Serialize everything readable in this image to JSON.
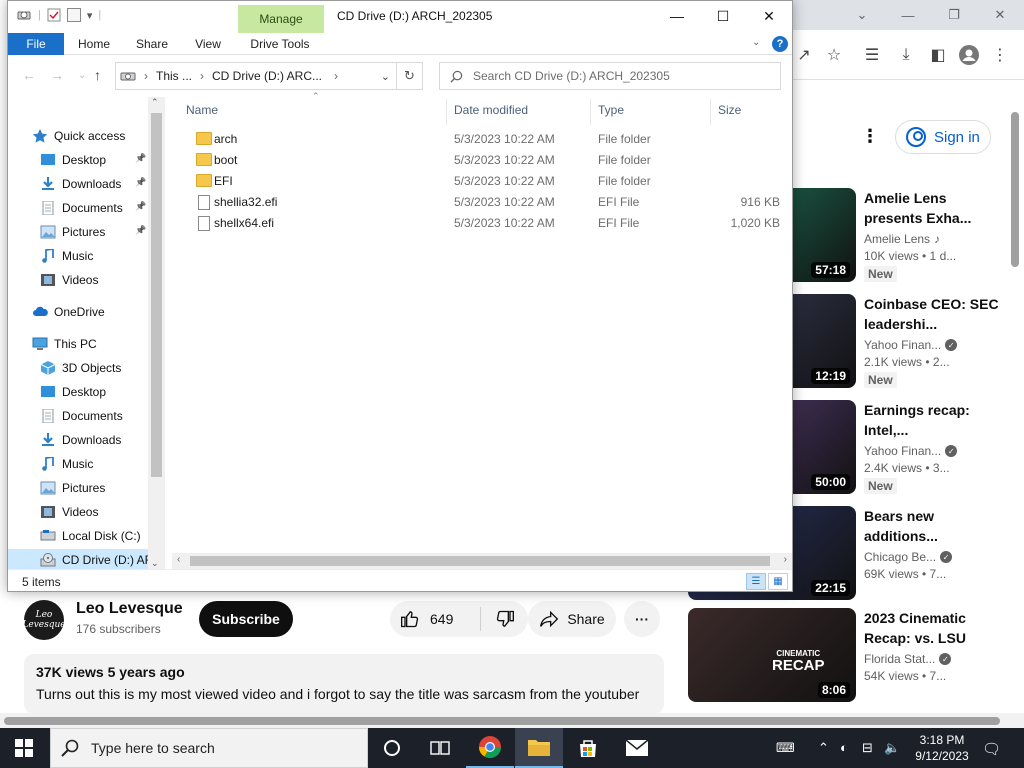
{
  "explorer": {
    "title": "CD Drive (D:) ARCH_202305",
    "manage_tab": "Manage",
    "ribbon_tabs": [
      "File",
      "Home",
      "Share",
      "View",
      "Drive Tools"
    ],
    "address": {
      "segment1": "This ...",
      "segment2": "CD Drive (D:) ARC..."
    },
    "search_placeholder": "Search CD Drive (D:) ARCH_202305",
    "columns": {
      "name": "Name",
      "date": "Date modified",
      "type": "Type",
      "size": "Size"
    },
    "files": [
      {
        "name": "arch",
        "date": "5/3/2023 10:22 AM",
        "type": "File folder",
        "size": "",
        "kind": "folder"
      },
      {
        "name": "boot",
        "date": "5/3/2023 10:22 AM",
        "type": "File folder",
        "size": "",
        "kind": "folder"
      },
      {
        "name": "EFI",
        "date": "5/3/2023 10:22 AM",
        "type": "File folder",
        "size": "",
        "kind": "folder"
      },
      {
        "name": "shellia32.efi",
        "date": "5/3/2023 10:22 AM",
        "type": "EFI File",
        "size": "916 KB",
        "kind": "file"
      },
      {
        "name": "shellx64.efi",
        "date": "5/3/2023 10:22 AM",
        "type": "EFI File",
        "size": "1,020 KB",
        "kind": "file"
      }
    ],
    "nav": {
      "quick_access": "Quick access",
      "qa_items": [
        "Desktop",
        "Downloads",
        "Documents",
        "Pictures",
        "Music",
        "Videos"
      ],
      "onedrive": "OneDrive",
      "this_pc": "This PC",
      "pc_items": [
        "3D Objects",
        "Desktop",
        "Documents",
        "Downloads",
        "Music",
        "Pictures",
        "Videos",
        "Local Disk (C:)",
        "CD Drive (D:) AR"
      ]
    },
    "status": "5 items",
    "colors": {
      "accent": "#1a6fc9",
      "manage": "#c7e8a0",
      "folder": "#f5c84c"
    }
  },
  "youtube": {
    "sign_in": "Sign in",
    "channel": {
      "name": "Leo Levesque",
      "subscribers": "176 subscribers",
      "avatar_text": "Leo Levesque",
      "subscribe": "Subscribe",
      "likes": "649",
      "share": "Share"
    },
    "description": {
      "stats": "37K views  5 years ago",
      "text": "Turns out this is my most viewed video and i forgot to say the title was sarcasm from the youtuber"
    },
    "recommendations": [
      {
        "title": "Amelie Lens presents Exha...",
        "channel": "Amelie Lens",
        "verified": false,
        "music": true,
        "views": "10K views  •  1 d...",
        "badge": "New",
        "duration": "57:18",
        "thumb_color": "#1f7a5e"
      },
      {
        "title": "Coinbase CEO: SEC leadershi...",
        "channel": "Yahoo Finan...",
        "verified": true,
        "music": false,
        "views": "2.1K views  •  2...",
        "badge": "New",
        "duration": "12:19",
        "thumb_color": "#3a3f5c"
      },
      {
        "title": "Earnings recap: Intel,...",
        "channel": "Yahoo Finan...",
        "verified": true,
        "music": false,
        "views": "2.4K views  •  3...",
        "badge": "New",
        "duration": "50:00",
        "thumb_color": "#5a3f7a"
      },
      {
        "title": "Bears new additions...",
        "channel": "Chicago Be...",
        "verified": true,
        "music": false,
        "views": "69K views  •  7...",
        "badge": "",
        "duration": "22:15",
        "thumb_color": "#2c3566"
      },
      {
        "title": "2023 Cinematic Recap: vs. LSU",
        "channel": "Florida Stat...",
        "verified": true,
        "music": false,
        "views": "54K views  •  7...",
        "badge": "",
        "duration": "8:06",
        "thumb_color": "#3b2a2a"
      }
    ],
    "thumb_overlay": {
      "recap_top": "CINEMATIC",
      "recap_bottom": "RECAP"
    }
  },
  "taskbar": {
    "search_placeholder": "Type here to search",
    "time": "3:18 PM",
    "date": "9/12/2023"
  }
}
